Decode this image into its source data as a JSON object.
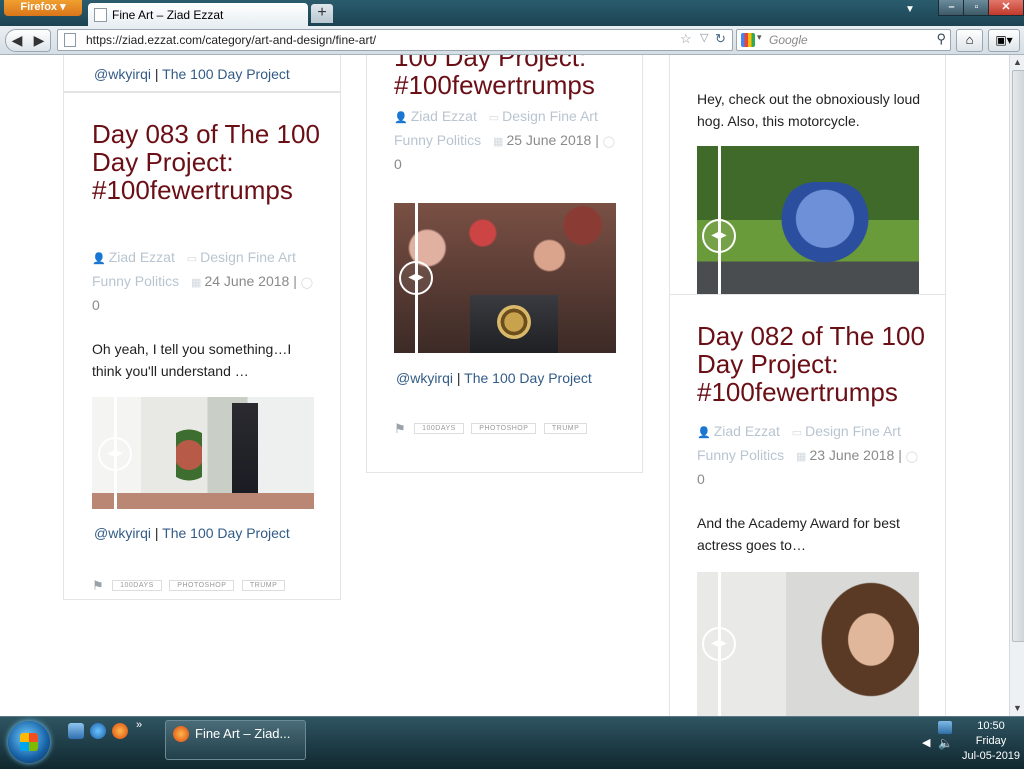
{
  "browser": {
    "menu_label": "Firefox",
    "tab_title": "Fine Art – Ziad Ezzat",
    "new_tab": "+",
    "url": "https://ziad.ezzat.com/category/art-and-design/fine-art/",
    "search_placeholder": "Google"
  },
  "posts": {
    "col1_prev_byline": {
      "user": "@wkyirqi",
      "sep": "|",
      "project": "The 100 Day Project"
    },
    "day083": {
      "title": "Day 083 of The 100 Day Project: #100fewertrumps",
      "author": "Ziad Ezzat",
      "categories": "Design Fine Art Funny Politics",
      "date": "24 June 2018",
      "comments": "0",
      "excerpt": "Oh yeah, I tell you something…I think you'll understand …",
      "byline_user": "@wkyirqi",
      "byline_sep": "|",
      "byline_project": "The 100 Day Project",
      "tags": [
        "100DAYS",
        "PHOTOSHOP",
        "TRUMP"
      ]
    },
    "col2_post": {
      "title_tail": "100 Day Project: #100fewertrumps",
      "author": "Ziad Ezzat",
      "categories": "Design Fine Art Funny Politics",
      "date": "25 June 2018",
      "comments": "0",
      "byline_user": "@wkyirqi",
      "byline_sep": "|",
      "byline_project": "The 100 Day Project",
      "tags": [
        "100DAYS",
        "PHOTOSHOP",
        "TRUMP"
      ]
    },
    "col3_prev": {
      "excerpt": "Hey, check out the obnoxiously loud hog. Also, this motorcycle."
    },
    "day082": {
      "title": "Day 082 of The 100 Day Project: #100fewertrumps",
      "author": "Ziad Ezzat",
      "categories": "Design Fine Art Funny Politics",
      "date": "23 June 2018",
      "comments": "0",
      "excerpt": "And the Academy Award for best actress goes to…"
    }
  },
  "taskbar": {
    "task_label": "Fine Art – Ziad...",
    "time": "10:50",
    "day": "Friday",
    "date": "Jul-05-2019"
  },
  "colors": {
    "title": "#6b0f16",
    "link": "#325b86",
    "meta": "#b8c5d0"
  }
}
